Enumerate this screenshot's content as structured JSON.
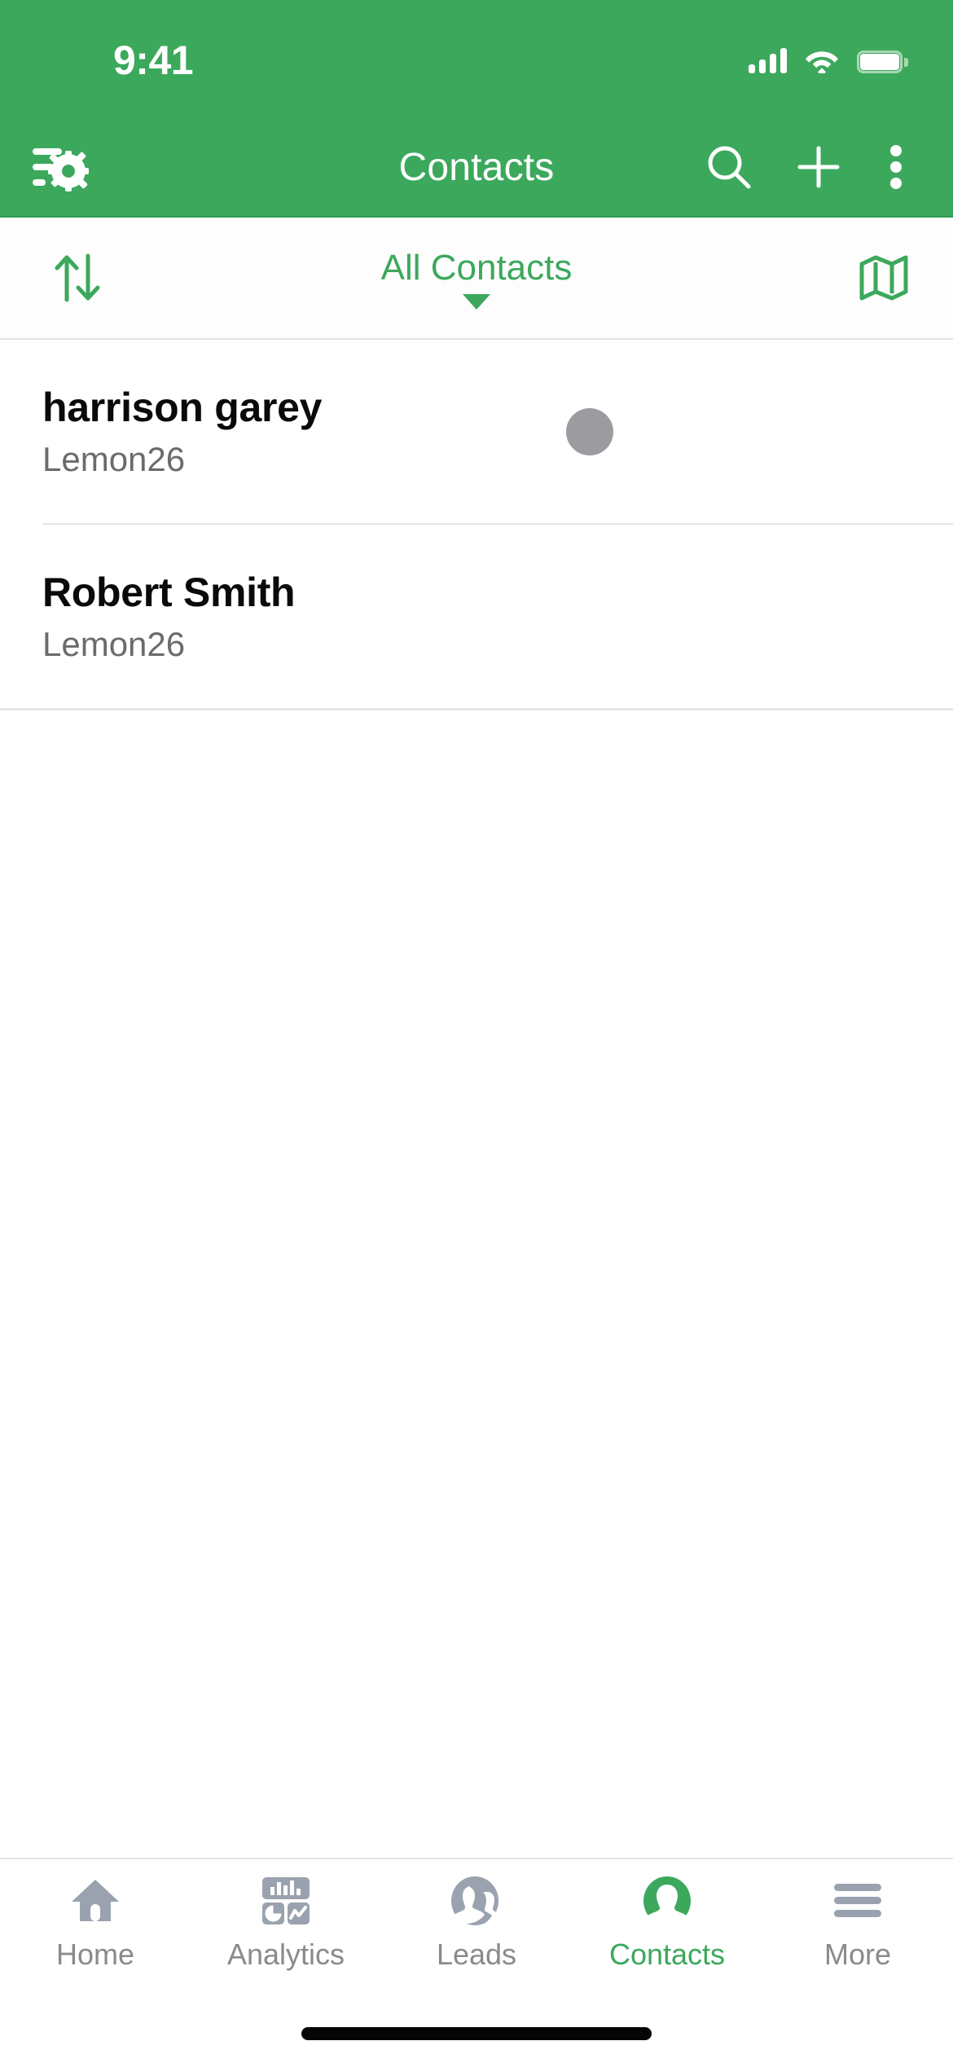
{
  "theme": {
    "brand_green": "#3CA85C",
    "inactive_gray": "#8A8A8E",
    "divider": "#E6E6E8",
    "avatar_gray": "#9B9BA0"
  },
  "status_bar": {
    "time": "9:41",
    "cellular_icon": "cellular-bars-icon",
    "wifi_icon": "wifi-icon",
    "battery_icon": "battery-icon"
  },
  "nav_bar": {
    "title": "Contacts",
    "left_icon": "filter-settings-icon",
    "search_icon": "search-icon",
    "add_icon": "plus-icon",
    "overflow_icon": "more-vertical-icon"
  },
  "filter_bar": {
    "sort_icon": "sort-arrows-icon",
    "selected_view": "All Contacts",
    "caret_icon": "chevron-down-icon",
    "map_icon": "map-icon"
  },
  "contacts": [
    {
      "name": "harrison garey",
      "subtitle": "Lemon26",
      "has_avatar": true
    },
    {
      "name": "Robert Smith",
      "subtitle": "Lemon26",
      "has_avatar": false
    }
  ],
  "tab_bar": {
    "items": [
      {
        "label": "Home",
        "icon": "house-icon",
        "active": false
      },
      {
        "label": "Analytics",
        "icon": "dashboard-charts-icon",
        "active": false
      },
      {
        "label": "Leads",
        "icon": "two-people-icon",
        "active": false
      },
      {
        "label": "Contacts",
        "icon": "person-icon",
        "active": true
      },
      {
        "label": "More",
        "icon": "hamburger-icon",
        "active": false
      }
    ]
  }
}
